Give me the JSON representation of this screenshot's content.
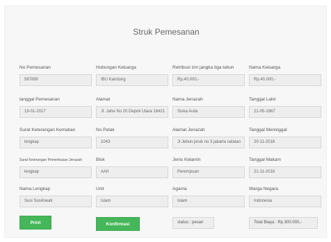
{
  "title": "Struk Pemesanan",
  "fields": {
    "no_pemesanan": {
      "label": "No Pemesanan",
      "value": "567890"
    },
    "hubungan_keluarga": {
      "label": "Hubungan Keluarga",
      "value": "IBU Kandung"
    },
    "retribusi": {
      "label": "Retribusi izin jangka tiga tahun",
      "value": "Rp.40.000,-"
    },
    "nama_keluarga": {
      "label": "Nama Keluarga",
      "value": "Rp.40.000,-"
    },
    "tanggal_pemesanan": {
      "label": "tanggal Pemesanan",
      "value": "19-01-2017"
    },
    "alamat": {
      "label": "Alamat",
      "value": "Jl. Jahe No 20 Depok Utara 16421"
    },
    "nama_jenazah": {
      "label": "Nama Jenazah",
      "value": "Siska Aulia"
    },
    "tanggal_lahir": {
      "label": "Tanggal Lahir",
      "value": "21-05-1967"
    },
    "surat_kematian": {
      "label": "Surat Keterangan Kematian",
      "value": "lengkap"
    },
    "no_petak": {
      "label": "No Petak",
      "value": "1043"
    },
    "alamat_jenazah": {
      "label": "Alamat Jenazah",
      "value": "Jl Jebun jeruk no 3 jakarta selatan"
    },
    "tanggal_meninggal": {
      "label": "Tanggal Meninggal",
      "value": "20-11-2016"
    },
    "surat_pemeriksaan": {
      "label": "Surat Keterangan Pemeriksaan Jenazah",
      "value": "lengkap"
    },
    "blok": {
      "label": "Blok",
      "value": "AAII"
    },
    "jenis_kelamin": {
      "label": "Jenis Kelamin",
      "value": "Perempuan"
    },
    "tanggal_makam": {
      "label": "Tanggal Makam",
      "value": "21-11-2016"
    },
    "nama_lengkap": {
      "label": "Nama Lengkap",
      "value": "Susi Susilowati"
    },
    "unit": {
      "label": "Unit",
      "value": "Islam"
    },
    "agama": {
      "label": "Agama",
      "value": "Islam"
    },
    "warga_negara": {
      "label": "Warga Negara",
      "value": "Indonesia"
    }
  },
  "buttons": {
    "print": "Print",
    "konfirmasi": "Konfirmasi"
  },
  "status": "status : pesan",
  "total": "Total Biaya : Rp.300.000,-",
  "colors": {
    "button": "#45b75a",
    "input_bg": "#eeeeee",
    "panel_bg": "#f7f7f7"
  }
}
